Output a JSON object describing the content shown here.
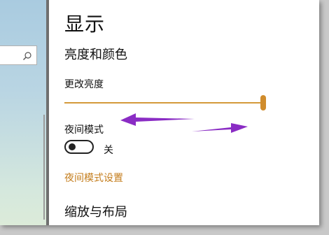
{
  "page": {
    "title": "显示"
  },
  "brightness_section": {
    "title": "亮度和颜色",
    "slider_label": "更改亮度",
    "brightness_level": 1.0
  },
  "night_mode": {
    "label": "夜间模式",
    "toggle_state_label": "关",
    "is_on": false,
    "settings_link": "夜间模式设置"
  },
  "scale_section": {
    "title": "缩放与布局"
  },
  "sidebar": {
    "search_icon": "search-icon"
  },
  "colors": {
    "accent": "#c47d1c",
    "slider": "#d49a3a",
    "annotation_arrow": "#8a2cc4"
  }
}
